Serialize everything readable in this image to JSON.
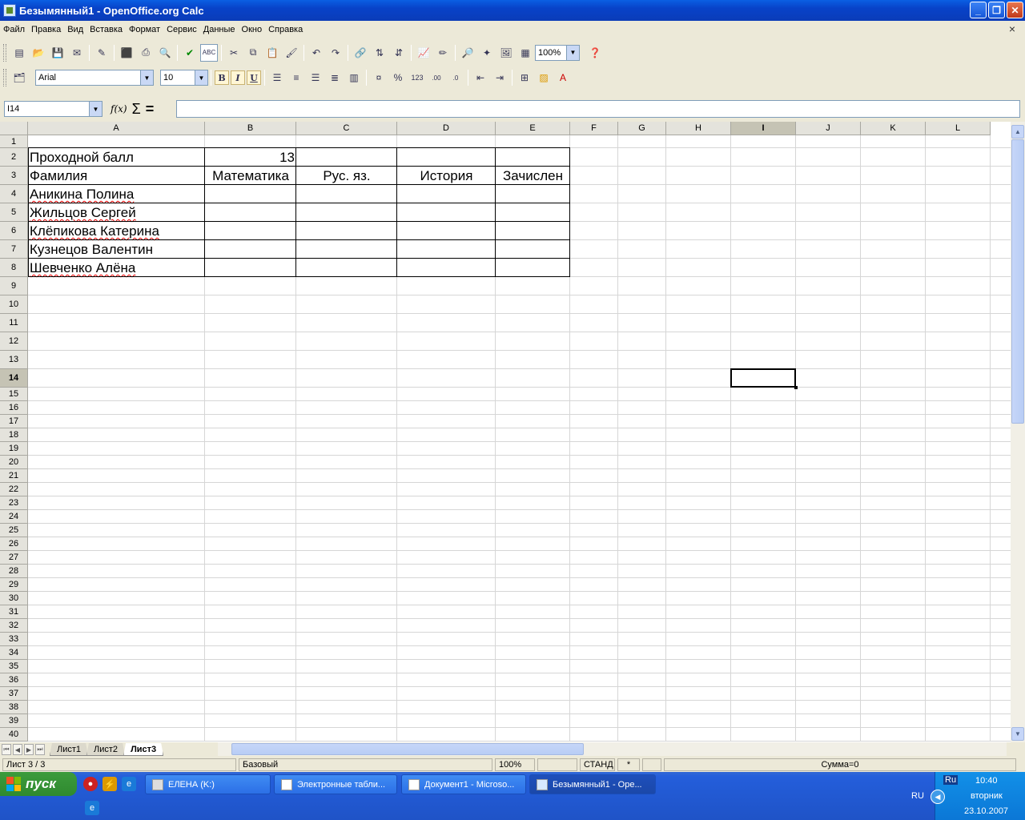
{
  "window": {
    "title": "Безымянный1 - OpenOffice.org Calc",
    "min_label": "_",
    "restore_label": "❐",
    "close_label": "✕"
  },
  "menu": {
    "items": [
      "Файл",
      "Правка",
      "Вид",
      "Вставка",
      "Формат",
      "Сервис",
      "Данные",
      "Окно",
      "Справка"
    ],
    "close_label": "×"
  },
  "toolbar": {
    "zoom": "100%",
    "font_name": "Arial",
    "font_size": "10",
    "bold": "B",
    "italic": "I",
    "underline": "U"
  },
  "formula": {
    "name_box": "I14",
    "input_value": ""
  },
  "grid": {
    "columns": [
      "A",
      "B",
      "C",
      "D",
      "E",
      "F",
      "G",
      "H",
      "I",
      "J",
      "K",
      "L"
    ],
    "selected_column": "I",
    "rows": [
      "1",
      "2",
      "3",
      "4",
      "5",
      "6",
      "7",
      "8",
      "9",
      "10",
      "11",
      "12",
      "13",
      "14",
      "15",
      "16",
      "17",
      "18",
      "19",
      "20",
      "21",
      "22",
      "23",
      "24",
      "25",
      "26",
      "27",
      "28",
      "29",
      "30",
      "31",
      "32",
      "33",
      "34",
      "35",
      "36",
      "37",
      "38",
      "39",
      "40"
    ],
    "selected_row": "14"
  },
  "cells": {
    "A2": "Проходной балл",
    "B2": "13",
    "A3": "Фамилия",
    "B3": "Математика",
    "C3": "Рус. яз.",
    "D3": "История",
    "E3": "Зачислен",
    "A4": "Аникина Полина",
    "A5": "Жильцов Сергей",
    "A6": "Клёпикова Катерина",
    "A7": "Кузнецов Валентин",
    "A8": "Шевченко Алёна"
  },
  "sheet_tabs": [
    "Лист1",
    "Лист2",
    "Лист3"
  ],
  "active_sheet": "Лист3",
  "status": {
    "sheet": "Лист 3 / 3",
    "style": "Базовый",
    "zoom": "100%",
    "mode": "СТАНД",
    "modified": "*",
    "sum": "Сумма=0"
  },
  "taskbar": {
    "start_label": "пуск",
    "tasks": [
      {
        "label": "ЕЛЕНА (K:)"
      },
      {
        "label": "Электронные табли..."
      },
      {
        "label": "Документ1 - Microso..."
      },
      {
        "label": "Безымянный1 - Ope..."
      }
    ],
    "lang_badge": "Ru",
    "lang": "RU",
    "time": "10:40",
    "day": "вторник",
    "date": "23.10.2007"
  },
  "colors": {
    "title_bar": "#0842c8",
    "cursor": "#000000",
    "spell_error": "#e00000"
  }
}
